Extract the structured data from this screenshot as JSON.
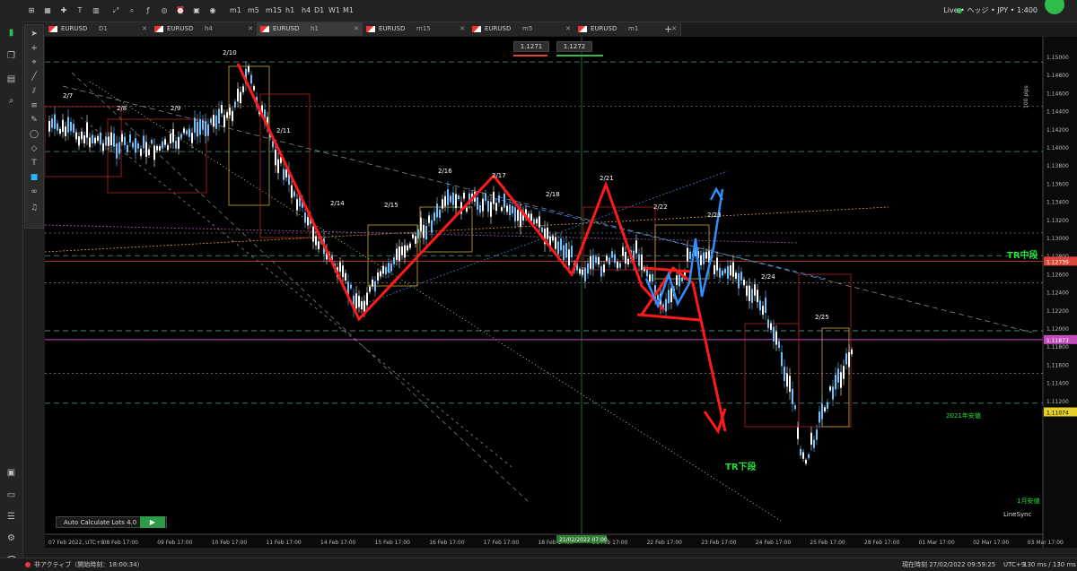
{
  "toolbar": {
    "timeframes": [
      "m1",
      "m5",
      "m15",
      "h1",
      "h4",
      "D1",
      "W1",
      "M1"
    ],
    "account_label": "Live • ヘッジ • JPY • 1:400"
  },
  "tabs": [
    {
      "symbol": "EURUSD",
      "tf": "D1"
    },
    {
      "symbol": "EURUSD",
      "tf": "h4"
    },
    {
      "symbol": "EURUSD",
      "tf": "h1"
    },
    {
      "symbol": "EURUSD",
      "tf": "m15"
    },
    {
      "symbol": "EURUSD",
      "tf": "m5"
    },
    {
      "symbol": "EURUSD",
      "tf": "m1"
    }
  ],
  "chart": {
    "bid": "1.1271",
    "ask": "1.1272",
    "pip_scale_label": "100 pips",
    "price_axis": [
      "1.15000",
      "1.14800",
      "1.14600",
      "1.14400",
      "1.14200",
      "1.14000",
      "1.13800",
      "1.13600",
      "1.13400",
      "1.13200",
      "1.13000",
      "1.12800",
      "1.12600",
      "1.12400",
      "1.12200",
      "1.12000",
      "1.11800",
      "1.11600",
      "1.11400",
      "1.11200"
    ],
    "price_markers": [
      {
        "value": "1.12739",
        "color": "#e0453b"
      },
      {
        "value": "1.11873",
        "color": "#c24dbb"
      },
      {
        "value": "1.11074",
        "color": "#e8d02a"
      }
    ],
    "time_axis": [
      "07 Feb 2022, UTC+9",
      "08 Feb 17:00",
      "09 Feb 17:00",
      "10 Feb 17:00",
      "11 Feb 17:00",
      "14 Feb 17:00",
      "15 Feb 17:00",
      "16 Feb 17:00",
      "17 Feb 17:00",
      "18 Feb 17:00",
      "21 Feb 17:00",
      "22 Feb 17:00",
      "23 Feb 17:00",
      "24 Feb 17:00",
      "25 Feb 17:00",
      "28 Feb 17:00",
      "01 Mar 17:00",
      "02 Mar 17:00",
      "03 Mar 17:00"
    ],
    "crosshair_time": "21/02/2022 07:00",
    "day_labels": [
      "2/7",
      "2/8",
      "2/9",
      "2/10",
      "2/11",
      "2/14",
      "2/15",
      "2/16",
      "2/17",
      "2/18",
      "2/21",
      "2/22",
      "2/23",
      "2/24",
      "2/25"
    ],
    "annotations": {
      "tr_mid": "TR中段",
      "tr_low": "TR下段",
      "year_low": "2021年安値",
      "month_low": "1月安値",
      "linesync": "LineSync"
    },
    "colors": {
      "zigzag": "#ff1a1a",
      "blue_path": "#2f8fff",
      "bull": "#6ec3ff",
      "bear": "#ffffff",
      "annotation_green": "#23e23a"
    }
  },
  "autocalc": {
    "label": "Auto Calculate Lots 4.0",
    "play": "▶"
  },
  "status": {
    "left": "非アクティブ（開始時刻：18:00:34）",
    "clock": "現在時刻  27/02/2022 09:59:25",
    "utc": "UTC+9",
    "latency": "130 ms / 130 ms"
  }
}
